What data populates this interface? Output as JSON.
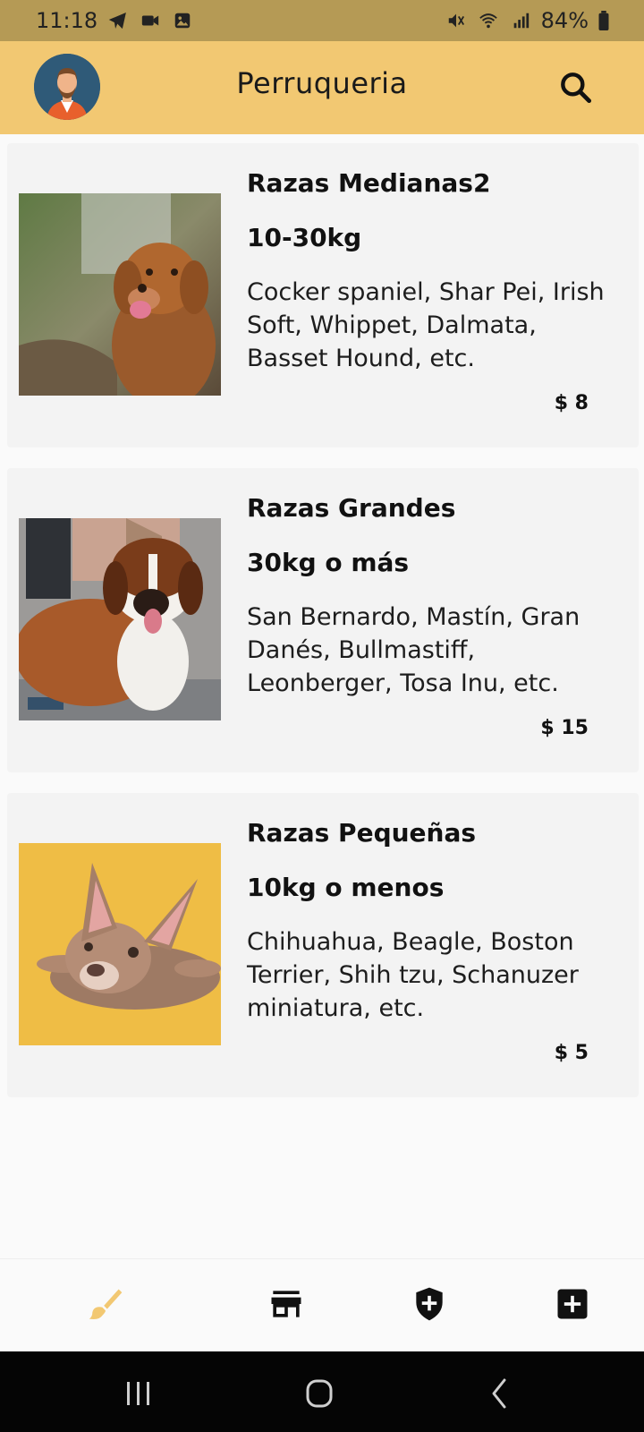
{
  "status_bar": {
    "time": "11:18",
    "battery": "84%",
    "icons_left": [
      "telegram-icon",
      "video-icon",
      "gallery-icon"
    ],
    "icons_right": [
      "mute-icon",
      "wifi-icon",
      "signal-icon",
      "battery-icon"
    ]
  },
  "app_bar": {
    "title": "Perruqueria",
    "avatar_icon": "user-avatar",
    "search_icon": "search-icon",
    "background": "#f2c872"
  },
  "cards": [
    {
      "title": "Razas Medianas2",
      "weight": "10-30kg",
      "description": "Cocker spaniel, Shar Pei, Irish Soft, Whippet, Dalmata, Basset Hound, etc.",
      "price": "$ 8",
      "image": "brown-dog-photo"
    },
    {
      "title": "Razas Grandes",
      "weight": "30kg o más",
      "description": "San Bernardo, Mastín, Gran Danés, Bullmastiff, Leonberger, Tosa Inu, etc.",
      "price": "$ 15",
      "image": "saint-bernard-photo"
    },
    {
      "title": "Razas Pequeñas",
      "weight": "10kg o menos",
      "description": "Chihuahua, Beagle, Boston Terrier, Shih tzu, Schanuzer miniatura, etc.",
      "price": "$ 5",
      "image": "french-bulldog-photo"
    }
  ],
  "bottom_nav": {
    "items": [
      "brush-icon",
      "store-icon",
      "shield-plus-icon",
      "add-box-icon"
    ],
    "active_color": "#f2c872",
    "inactive_color": "#111111"
  },
  "system_nav": [
    "recents-icon",
    "home-icon",
    "back-icon"
  ]
}
